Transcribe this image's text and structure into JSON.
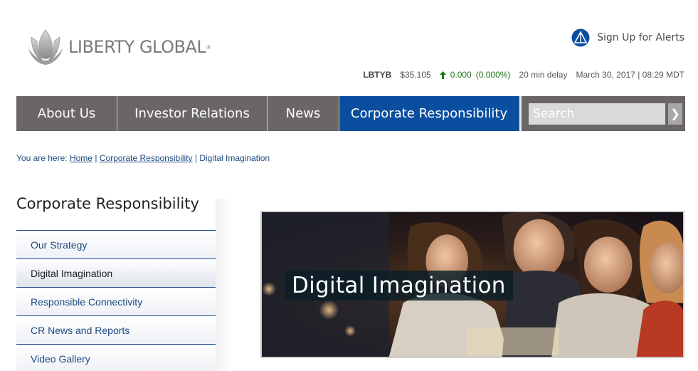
{
  "brand": {
    "name": "LIBERTY GLOBAL",
    "reg": "®"
  },
  "alerts": {
    "label": "Sign Up for Alerts"
  },
  "ticker": {
    "symbol": "LBTYB",
    "price": "$35.105",
    "change": "0.000",
    "change_pct": "(0.000%)",
    "delay": "20 min delay",
    "datetime": "March 30, 2017 | 08:29 MDT"
  },
  "nav": {
    "items": [
      {
        "label": "About Us"
      },
      {
        "label": "Investor Relations"
      },
      {
        "label": "News"
      },
      {
        "label": "Corporate Responsibility"
      }
    ],
    "search_placeholder": "Search",
    "search_button": "❯"
  },
  "breadcrumb": {
    "prefix": "You are here:",
    "home": "Home",
    "sep1": "|",
    "section": "Corporate Responsibility",
    "sep2": "|",
    "current": "Digital Imagination"
  },
  "sidebar": {
    "title": "Corporate Responsibility",
    "items": [
      {
        "label": "Our Strategy"
      },
      {
        "label": "Digital Imagination"
      },
      {
        "label": "Responsible Connectivity"
      },
      {
        "label": "CR News and Reports"
      },
      {
        "label": "Video Gallery"
      }
    ]
  },
  "hero": {
    "caption": "Digital Imagination"
  },
  "colors": {
    "nav_bg": "#6a6666",
    "nav_active": "#0a4ea0",
    "link": "#1e4a80",
    "up": "#1a7a1a"
  }
}
